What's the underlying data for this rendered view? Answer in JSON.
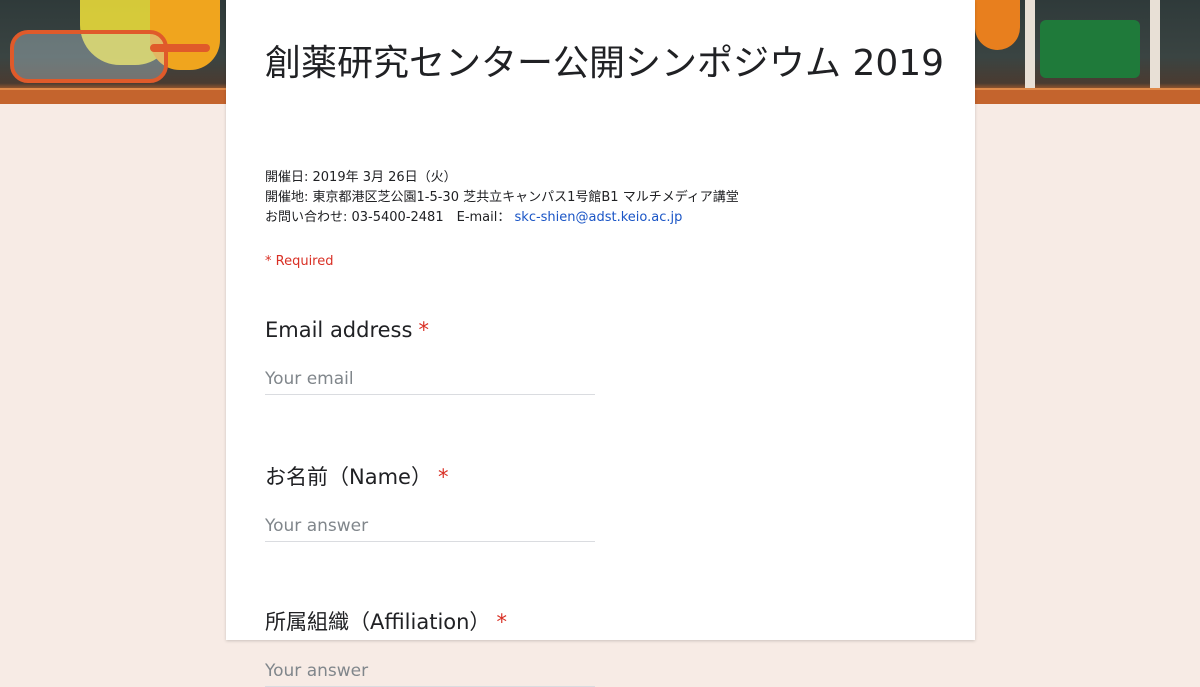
{
  "form": {
    "title": "創薬研究センター公開シンポジウム 2019",
    "description": {
      "date_line": "開催日: 2019年 3月 26日（火）",
      "venue_line": "開催地: 東京都港区芝公園1-5-30 芝共立キャンパス1号館B1 マルチメディア講堂",
      "contact_prefix": "お問い合わせ: 03-5400-2481　E-mail：",
      "contact_email": "skc-shien@adst.keio.ac.jp"
    },
    "required_note": "* Required",
    "questions": [
      {
        "label": "Email address",
        "required_mark": "*",
        "placeholder": "Your email"
      },
      {
        "label": "お名前（Name）",
        "required_mark": "*",
        "placeholder": "Your answer"
      },
      {
        "label": "所属組織（Affiliation）",
        "required_mark": "*",
        "placeholder": "Your answer"
      }
    ]
  },
  "colors": {
    "background": "#f7ebe5",
    "required": "#d93025",
    "link": "#1a55c6"
  }
}
